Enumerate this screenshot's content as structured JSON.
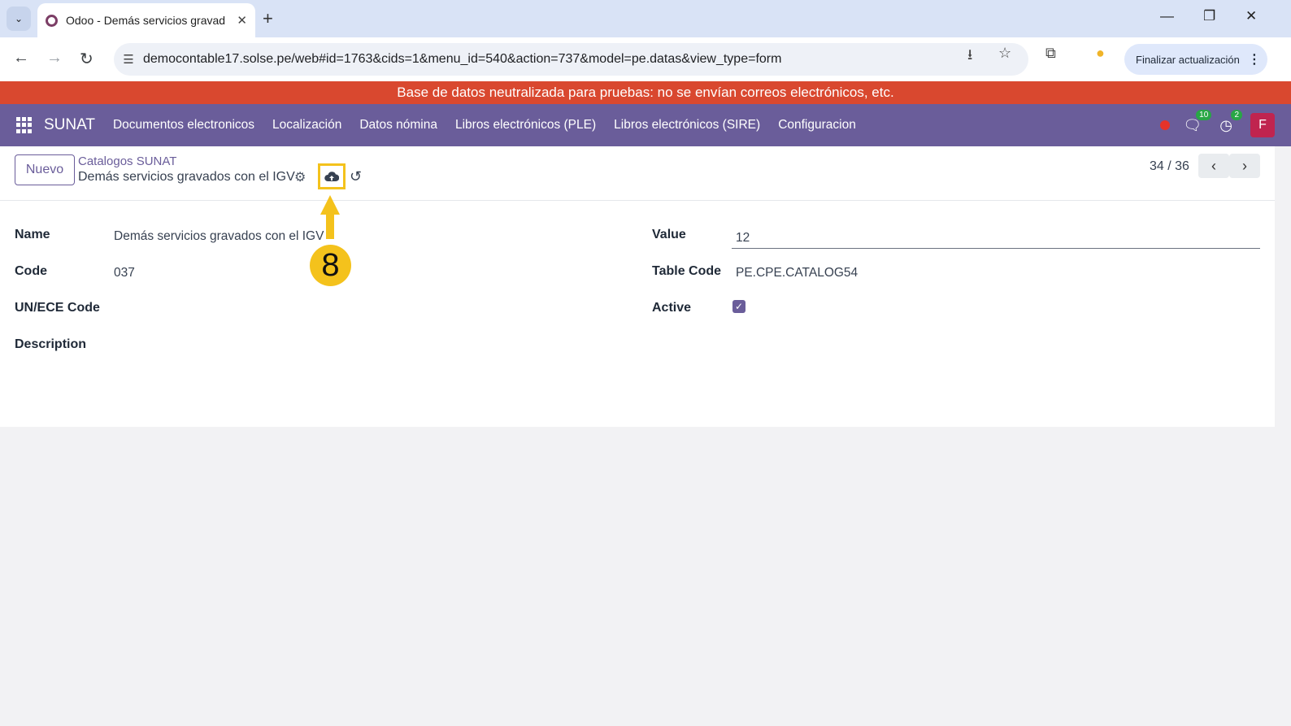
{
  "browser": {
    "tab_title": "Odoo - Demás servicios gravad",
    "url": "democontable17.solse.pe/web#id=1763&cids=1&menu_id=540&action=737&model=pe.datas&view_type=form",
    "update_button": "Finalizar actualización"
  },
  "banner": "Base de datos neutralizada para pruebas: no se envían correos electrónicos, etc.",
  "navbar": {
    "brand": "SUNAT",
    "menu": [
      "Documentos electronicos",
      "Localización",
      "Datos nómina",
      "Libros electrónicos (PLE)",
      "Libros electrónicos (SIRE)",
      "Configuracion"
    ],
    "messages_count": "10",
    "activities_count": "2",
    "avatar_letter": "F",
    "accent_color": "#6a5d9a"
  },
  "control_panel": {
    "new_button": "Nuevo",
    "breadcrumb": "Catalogos SUNAT",
    "record_name": "Demás servicios gravados con el IGV",
    "pager": "34 / 36"
  },
  "form": {
    "name_label": "Name",
    "name_value": "Demás servicios gravados con el IGV",
    "code_label": "Code",
    "code_value": "037",
    "unece_label": "UN/ECE Code",
    "description_label": "Description",
    "value_label": "Value",
    "value_value": "12",
    "table_code_label": "Table Code",
    "table_code_value": "PE.CPE.CATALOG54",
    "active_label": "Active",
    "active_checked": true
  },
  "annotation": {
    "step_number": "8",
    "color": "#f4c21c"
  }
}
